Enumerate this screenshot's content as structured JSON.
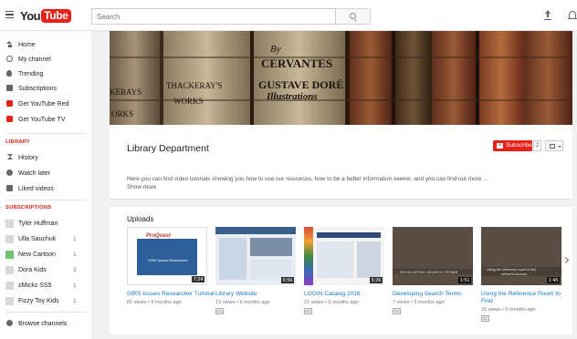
{
  "header": {
    "logo_you": "You",
    "logo_tube": "Tube",
    "search_placeholder": "Search",
    "icons": [
      "menu-icon",
      "search-icon",
      "upload-icon",
      "bell-icon"
    ]
  },
  "sidebar": {
    "main": [
      {
        "label": "Home",
        "icon": "home-icon"
      },
      {
        "label": "My channel",
        "icon": "account-icon"
      },
      {
        "label": "Trending",
        "icon": "flame-icon"
      },
      {
        "label": "Subscriptions",
        "icon": "subscriptions-icon"
      },
      {
        "label": "Get YouTube Red",
        "icon": "youtube-red-icon"
      },
      {
        "label": "Get YouTube TV",
        "icon": "youtube-tv-icon"
      }
    ],
    "library_heading": "LIBRARY",
    "library": [
      {
        "label": "History",
        "icon": "hourglass-icon"
      },
      {
        "label": "Watch later",
        "icon": "clock-icon"
      },
      {
        "label": "Liked videos",
        "icon": "thumbs-up-icon"
      }
    ],
    "subscriptions_heading": "SUBSCRIPTIONS",
    "subscriptions": [
      {
        "label": "Tyler Huffman",
        "count": ""
      },
      {
        "label": "Ulla Sauchuk",
        "count": "1"
      },
      {
        "label": "New Cartoon",
        "count": "1"
      },
      {
        "label": "Dora Kids",
        "count": "3"
      },
      {
        "label": "zMickz SS5",
        "count": "1"
      },
      {
        "label": "Fizzy Toy Kids",
        "count": "1"
      }
    ],
    "browse_channels": "Browse channels"
  },
  "banner": {
    "book_labels": [
      "CERVANTES",
      "GUSTAVE DORÉ",
      "Illustrations",
      "THACKERAY'S",
      "WORKS",
      "KERAYS",
      "ORKS",
      "By"
    ]
  },
  "channel": {
    "name": "Library Department",
    "subscribe_label": "Subscribe",
    "subscriber_count": "2",
    "description": "Here you can find video tutorials showing you how to use our resources, how to be a better information seeker, and you can find out more ...",
    "show_more": "Show more"
  },
  "uploads": {
    "title": "Uploads",
    "videos": [
      {
        "title": "SIRS Issues Researcher Tutorial",
        "meta": "81 views • 5 months ago",
        "duration": "7:24",
        "cc": "CC",
        "thumb_text_1": "ProQuest",
        "thumb_text_2": "SIRS Issues Researcher"
      },
      {
        "title": "Library Website",
        "meta": "13 views • 5 months ago",
        "duration": "5:56",
        "cc": "CC"
      },
      {
        "title": "LOGIN Catalog 2016",
        "meta": "15 views • 5 months ago",
        "duration": "5:26",
        "cc": "CC"
      },
      {
        "title": "Developing Search Terms",
        "meta": "7 views • 5 months ago",
        "duration": "1:51",
        "cc": "CC",
        "thumb_text_1": "DEVELOPING SEARCH TERMS"
      },
      {
        "title": "Using the Reference Room to Find",
        "meta": "15 views • 5 months ago",
        "duration": "1:45",
        "cc": "CC",
        "thumb_text_1": "Using the reference room to find",
        "thumb_text_2": "relevant sources"
      }
    ]
  },
  "colors": {
    "brand_red": "#e62117",
    "link_blue": "#167ac6",
    "background": "#f1f1f1"
  }
}
